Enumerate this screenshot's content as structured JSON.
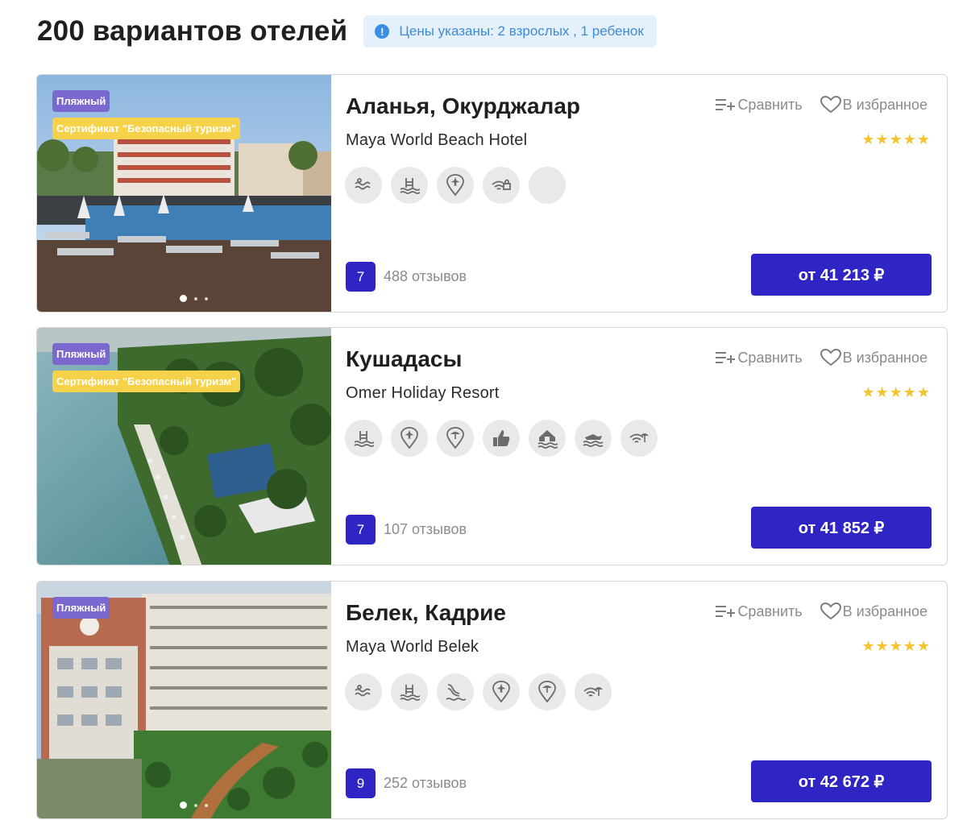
{
  "page": {
    "title": "200 вариантов отелей",
    "info_icon": "!",
    "prices_note": "Цены указаны: 2 взрослых , 1 ребенок"
  },
  "labels": {
    "compare": "Сравнить",
    "favorite": "В избранное"
  },
  "colors": {
    "accent": "#2f24c4",
    "stars": "#f4c430",
    "beach_tag": "#7a68cf",
    "cert_tag": "#f6d24a",
    "info_bg": "#e4f0fb",
    "info_text": "#3f8bd6"
  },
  "hotels": [
    {
      "city": "Аланья, Окурджалар",
      "name": "Maya World Beach Hotel",
      "tag_beach": "Пляжный",
      "tag_cert": "Сертификат \"Безопасный туризм\"",
      "stars": "★★★★★",
      "star_count": 5,
      "amenity_icons": [
        "waves-icon",
        "pool-icon",
        "airport-pin-icon",
        "wifi-lock-icon",
        "placeholder-icon"
      ],
      "rating": "7",
      "reviews": "488 отзывов",
      "price": "от 41 213 ₽",
      "photo_dots": 3,
      "active_dot": 0
    },
    {
      "city": "Кушадасы",
      "name": "Omer Holiday Resort",
      "tag_beach": "Пляжный",
      "tag_cert": "Сертификат \"Безопасный туризм\"",
      "stars": "★★★★★",
      "star_count": 5,
      "amenity_icons": [
        "pool-icon",
        "airport-pin-icon",
        "beach-pin-icon",
        "thumbs-up-icon",
        "house-waves-icon",
        "jetski-waves-icon",
        "wifi-umbrella-icon"
      ],
      "rating": "7",
      "reviews": "107 отзывов",
      "price": "от 41 852 ₽"
    },
    {
      "city": "Белек, Кадрие",
      "name": "Maya World Belek",
      "tag_beach": "Пляжный",
      "stars": "★★★★★",
      "star_count": 5,
      "amenity_icons": [
        "waves-icon",
        "pool-icon",
        "waterslide-icon",
        "airport-pin-icon",
        "beach-pin-icon",
        "wifi-umbrella-icon"
      ],
      "rating": "9",
      "reviews": "252 отзывов",
      "price": "от 42 672 ₽",
      "photo_dots": 3,
      "active_dot": 0
    }
  ]
}
